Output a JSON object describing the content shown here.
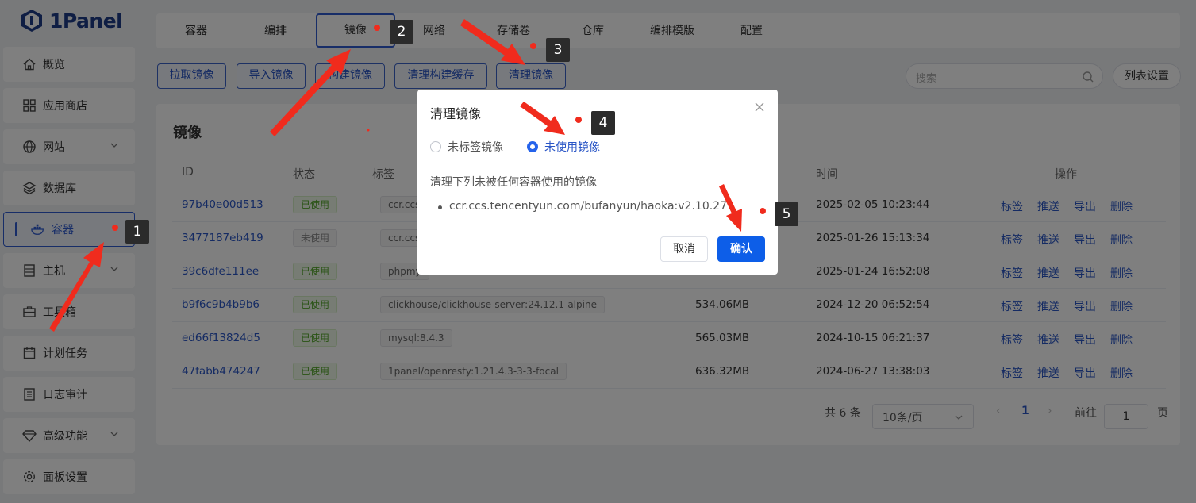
{
  "app": {
    "logo_text": "1Panel"
  },
  "sidebar": {
    "items": [
      {
        "label": "概览",
        "icon": "home-icon",
        "has_chevron": false
      },
      {
        "label": "应用商店",
        "icon": "apps-grid-icon",
        "has_chevron": false
      },
      {
        "label": "网站",
        "icon": "globe-icon",
        "has_chevron": true
      },
      {
        "label": "数据库",
        "icon": "layers-icon",
        "has_chevron": false
      },
      {
        "label": "容器",
        "icon": "docker-icon",
        "has_chevron": false,
        "active": true
      },
      {
        "label": "主机",
        "icon": "host-icon",
        "has_chevron": true
      },
      {
        "label": "工具箱",
        "icon": "toolbox-icon",
        "has_chevron": false
      },
      {
        "label": "计划任务",
        "icon": "calendar-icon",
        "has_chevron": false
      },
      {
        "label": "日志审计",
        "icon": "log-icon",
        "has_chevron": false
      },
      {
        "label": "高级功能",
        "icon": "diamond-icon",
        "has_chevron": true
      },
      {
        "label": "面板设置",
        "icon": "gear-icon",
        "has_chevron": false
      }
    ]
  },
  "tabs": [
    {
      "label": "容器"
    },
    {
      "label": "编排"
    },
    {
      "label": "镜像",
      "active": true
    },
    {
      "label": "网络"
    },
    {
      "label": "存储卷"
    },
    {
      "label": "仓库"
    },
    {
      "label": "编排模版"
    },
    {
      "label": "配置"
    }
  ],
  "toolbar": {
    "buttons": [
      "拉取镜像",
      "导入镜像",
      "构建镜像",
      "清理构建缓存",
      "清理镜像"
    ],
    "search_placeholder": "搜索",
    "list_settings": "列表设置"
  },
  "card": {
    "title": "镜像",
    "columns": {
      "id": "ID",
      "status": "状态",
      "tag": "标签",
      "time": "时间",
      "ops": "操作"
    },
    "rows": [
      {
        "id": "97b40e00d513",
        "status": "已使用",
        "used": true,
        "tag": "ccr.ccs",
        "size": "",
        "time": "2025-02-05 10:23:44"
      },
      {
        "id": "3477187eb419",
        "status": "未使用",
        "used": false,
        "tag": "ccr.ccs",
        "size": "",
        "time": "2025-01-26 15:13:34"
      },
      {
        "id": "39c6dfe111ee",
        "status": "已使用",
        "used": true,
        "tag": "phpmy",
        "size": "",
        "time": "2025-01-24 16:52:08"
      },
      {
        "id": "b9f6c9b4b9b6",
        "status": "已使用",
        "used": true,
        "tag": "clickhouse/clickhouse-server:24.12.1-alpine",
        "size": "534.06MB",
        "time": "2024-12-20 06:52:54"
      },
      {
        "id": "ed66f13824d5",
        "status": "已使用",
        "used": true,
        "tag": "mysql:8.4.3",
        "size": "565.03MB",
        "time": "2024-10-15 06:21:37"
      },
      {
        "id": "47fabb474247",
        "status": "已使用",
        "used": true,
        "tag": "1panel/openresty:1.21.4.3-3-3-focal",
        "size": "636.32MB",
        "time": "2024-06-27 13:38:03"
      }
    ],
    "ops": [
      "标签",
      "推送",
      "导出",
      "删除"
    ],
    "pagination": {
      "total": "共 6 条",
      "page_size": "10条/页",
      "prev": "‹",
      "current": "1",
      "next": "›",
      "goto_label": "前往",
      "goto_value": "1",
      "page_suffix": "页"
    }
  },
  "dialog": {
    "title": "清理镜像",
    "options": [
      {
        "label": "未标签镜像",
        "checked": false
      },
      {
        "label": "未使用镜像",
        "checked": true
      }
    ],
    "description": "清理下列未被任何容器使用的镜像",
    "items": [
      "ccr.ccs.tencentyun.com/bufanyun/haoka:v2.10.27"
    ],
    "cancel": "取消",
    "confirm": "确认"
  },
  "annotations": {
    "markers": [
      "1",
      "2",
      "3",
      "4",
      "5"
    ],
    "color": "#f02b1d"
  },
  "colors": {
    "brand": "#1f3c88",
    "primary": "#2a56c6",
    "confirm": "#0d5ee8",
    "success": "#52a629"
  }
}
